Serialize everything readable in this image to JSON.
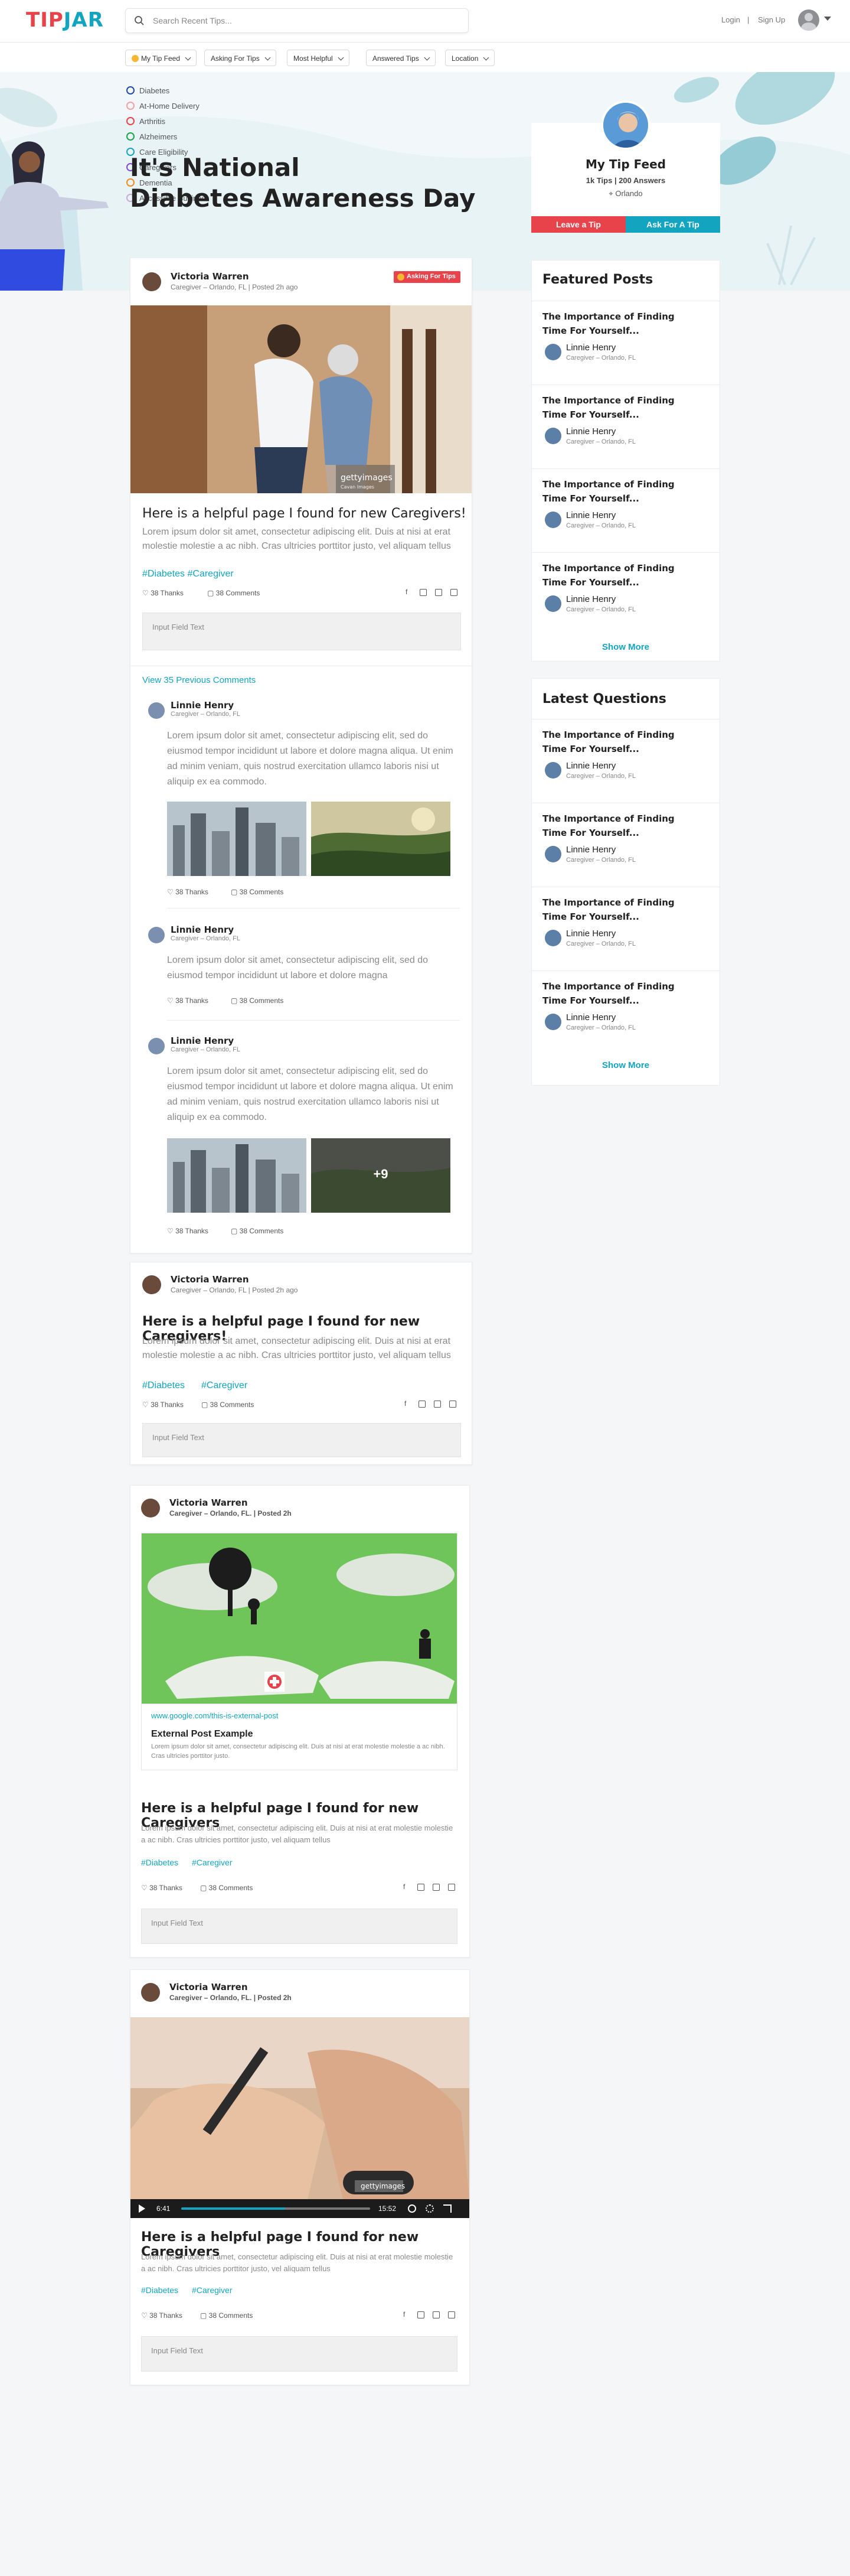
{
  "header": {
    "logo_tip": "TIP",
    "logo_jar": "JAR",
    "search_placeholder": "Search Recent Tips...",
    "login": "Login",
    "divider": "|",
    "signup": "Sign Up"
  },
  "filters": [
    "My Tip Feed",
    "Asking For Tips",
    "Most Helpful",
    "Answered Tips",
    "Location"
  ],
  "dropdown": [
    {
      "label": "Diabetes",
      "color": "#1f4aa8"
    },
    {
      "label": "At-Home Delivery",
      "color": "#f2a0a6"
    },
    {
      "label": "Arthritis",
      "color": "#e8424b"
    },
    {
      "label": "Alzheimers",
      "color": "#1aa34a"
    },
    {
      "label": "Care Eligibility",
      "color": "#13a4bf"
    },
    {
      "label": "Caregivers",
      "color": "#7e4bd1"
    },
    {
      "label": "Dementia",
      "color": "#f28a1d"
    },
    {
      "label": "Accessible Business",
      "color": "#c8a9d8"
    }
  ],
  "hero": {
    "headline_l1": "It's National",
    "headline_l2": "Diabetes Awareness Day"
  },
  "profile": {
    "name": "My Tip Feed",
    "stats": "1k Tips | 200 Answers",
    "location": "Orlando",
    "leave_tip": "Leave a Tip",
    "ask_tip": "Ask For A Tip"
  },
  "post1": {
    "author": "Victoria Warren",
    "meta": "Caregiver – Orlando, FL  |  Posted 2h ago",
    "badge": "Asking For Tips",
    "title": "Here is a helpful page I found for new Caregivers!",
    "body": "Lorem ipsum dolor sit amet, consectetur adipiscing elit. Duis at nisi at erat molestie molestie a ac nibh. Cras ultricies porttitor justo, vel aliquam tellus",
    "tags": "#Diabetes #Caregiver",
    "thanks": "38 Thanks",
    "comments": "38 Comments",
    "input": "Input Field Text",
    "view_prev": "View 35 Previous Comments",
    "watermark": "gettyimages",
    "watermark_credit": "Cavan Images",
    "c1": {
      "name": "Linnie Henry",
      "meta": "Caregiver – Orlando, FL",
      "text": "Lorem ipsum dolor sit amet, consectetur adipiscing elit, sed do eiusmod tempor incididunt ut labore et dolore magna aliqua. Ut enim ad minim veniam, quis nostrud exercitation ullamco laboris nisi ut aliquip ex ea commodo.",
      "thanks": "38 Thanks",
      "comments": "38 Comments"
    },
    "c2": {
      "name": "Linnie Henry",
      "meta": "Caregiver – Orlando, FL",
      "text": "Lorem ipsum dolor sit amet, consectetur adipiscing elit, sed do eiusmod tempor incididunt ut labore et dolore magna",
      "thanks": "38 Thanks",
      "comments": "38 Comments"
    },
    "c3": {
      "name": "Linnie Henry",
      "meta": "Caregiver – Orlando, FL",
      "text": "Lorem ipsum dolor sit amet, consectetur adipiscing elit, sed do eiusmod tempor incididunt ut labore et dolore magna aliqua. Ut enim ad minim veniam, quis nostrud exercitation ullamco laboris nisi ut aliquip ex ea commodo.",
      "more": "+9",
      "thanks": "38 Thanks",
      "comments": "38 Comments"
    }
  },
  "post2": {
    "author": "Victoria Warren",
    "meta": "Caregiver – Orlando, FL  |  Posted 2h ago",
    "title": "Here is a helpful page I found for new Caregivers!",
    "body": "Lorem ipsum dolor sit amet, consectetur adipiscing elit. Duis at nisi at erat molestie molestie a ac nibh. Cras ultricies porttitor justo, vel aliquam tellus",
    "tag1": "#Diabetes",
    "tag2": "#Caregiver",
    "thanks": "38 Thanks",
    "comments": "38 Comments",
    "input": "Input Field Text"
  },
  "post3": {
    "author": "Victoria Warren",
    "meta": "Caregiver – Orlando, FL. | Posted 2h",
    "url": "www.google.com/this-is-external-post",
    "ext_title": "External Post Example",
    "ext_body": "Lorem ipsum dolor sit amet, consectetur adipiscing elit. Duis at nisi at erat molestie molestie a ac nibh. Cras ultricies porttitor justo.",
    "title": "Here is a helpful page I found for new Caregivers",
    "body": "Lorem ipsum dolor sit amet, consectetur adipiscing elit. Duis at nisi at erat molestie molestie a ac nibh. Cras ultricies porttitor justo, vel aliquam tellus",
    "tag1": "#Diabetes",
    "tag2": "#Caregiver",
    "thanks": "38 Thanks",
    "comments": "38 Comments",
    "input": "Input Field Text"
  },
  "post4": {
    "author": "Victoria Warren",
    "meta": "Caregiver – Orlando, FL. | Posted 2h",
    "time_now": "6:41",
    "time_total": "15:52",
    "progress": 0.55,
    "watermark": "gettyimages",
    "title": "Here is a helpful page I found for new Caregivers",
    "body": "Lorem ipsum dolor sit amet, consectetur adipiscing elit. Duis at nisi at erat molestie molestie a ac nibh. Cras ultricies porttitor justo, vel aliquam tellus",
    "tag1": "#Diabetes",
    "tag2": "#Caregiver",
    "thanks": "38 Thanks",
    "comments": "38 Comments",
    "input": "Input Field Text"
  },
  "featured": {
    "title": "Featured Posts",
    "items": [
      {
        "title": "The Importance of Finding Time For Yourself...",
        "name": "Linnie Henry",
        "meta": "Caregiver – Orlando, FL"
      },
      {
        "title": "The Importance of Finding Time For Yourself...",
        "name": "Linnie Henry",
        "meta": "Caregiver – Orlando, FL"
      },
      {
        "title": "The Importance of Finding Time For Yourself...",
        "name": "Linnie Henry",
        "meta": "Caregiver – Orlando, FL"
      },
      {
        "title": "The Importance of Finding Time For Yourself...",
        "name": "Linnie Henry",
        "meta": "Caregiver – Orlando, FL"
      }
    ],
    "more": "Show More"
  },
  "latest": {
    "title": "Latest Questions",
    "items": [
      {
        "title": "The Importance of Finding Time For Yourself...",
        "name": "Linnie Henry",
        "meta": "Caregiver – Orlando, FL"
      },
      {
        "title": "The Importance of Finding Time For Yourself...",
        "name": "Linnie Henry",
        "meta": "Caregiver – Orlando, FL"
      },
      {
        "title": "The Importance of Finding Time For Yourself...",
        "name": "Linnie Henry",
        "meta": "Caregiver – Orlando, FL"
      },
      {
        "title": "The Importance of Finding Time For Yourself...",
        "name": "Linnie Henry",
        "meta": "Caregiver – Orlando, FL"
      }
    ],
    "more": "Show More"
  },
  "colors": {
    "brand_red": "#e8424b",
    "brand_teal": "#13a4bf"
  }
}
